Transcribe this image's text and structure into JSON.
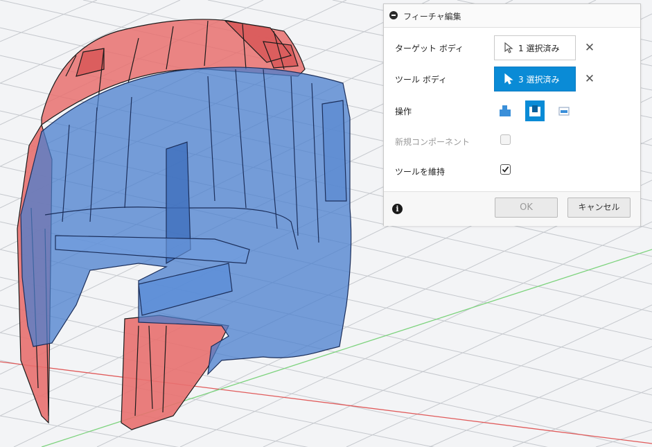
{
  "dialog": {
    "title": "フィーチャ編集",
    "target_body": {
      "label": "ターゲット ボディ",
      "button": "1 選択済み"
    },
    "tool_body": {
      "label": "ツール ボディ",
      "button": "3 選択済み"
    },
    "operation": {
      "label": "操作",
      "options": [
        "join-icon",
        "cut-icon",
        "intersect-icon"
      ],
      "selected": "cut-icon"
    },
    "new_component": {
      "label": "新規コンポーネント",
      "checked": false,
      "enabled": false
    },
    "keep_tools": {
      "label": "ツールを維持",
      "checked": true
    },
    "ok": "OK",
    "cancel": "キャンセル"
  },
  "colors": {
    "accent": "#0a8bd6",
    "target_body": "#e8706f",
    "tool_body": "#4a7fce",
    "x_axis": "#e05a5a",
    "y_axis": "#7dd37d"
  }
}
